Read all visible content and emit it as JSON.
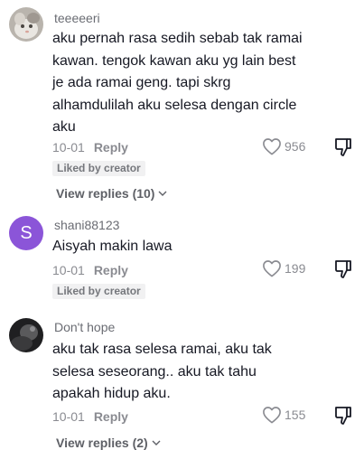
{
  "comments": [
    {
      "username": "teeeeeri",
      "avatar_icon": "cat-photo-avatar",
      "text": "aku pernah rasa sedih sebab tak ramai\nkawan. tengok kawan aku yg lain best\nje ada ramai geng. tapi skrg\nalhamdulilah aku selesa dengan circle\naku",
      "date": "10-01",
      "reply_label": "Reply",
      "likes": "956",
      "badge": "Liked by creator",
      "view_replies": "View replies (10)"
    },
    {
      "username": "shani88123",
      "avatar_letter": "S",
      "avatar_color": "#8b55d8",
      "text": "Aisyah makin lawa",
      "date": "10-01",
      "reply_label": "Reply",
      "likes": "199",
      "badge": "Liked by creator"
    },
    {
      "username": "Don't hope",
      "avatar_icon": "dark-photo-avatar",
      "text": "aku tak rasa selesa ramai, aku tak\nselesa seseorang.. aku tak tahu\napakah hidup aku.",
      "date": "10-01",
      "reply_label": "Reply",
      "likes": "155",
      "view_replies": "View replies (2)"
    }
  ],
  "colors": {
    "text_primary": "#161823",
    "text_secondary": "#8a8b91",
    "badge_bg": "#f1f1f2",
    "avatar_purple": "#8b55d8"
  }
}
